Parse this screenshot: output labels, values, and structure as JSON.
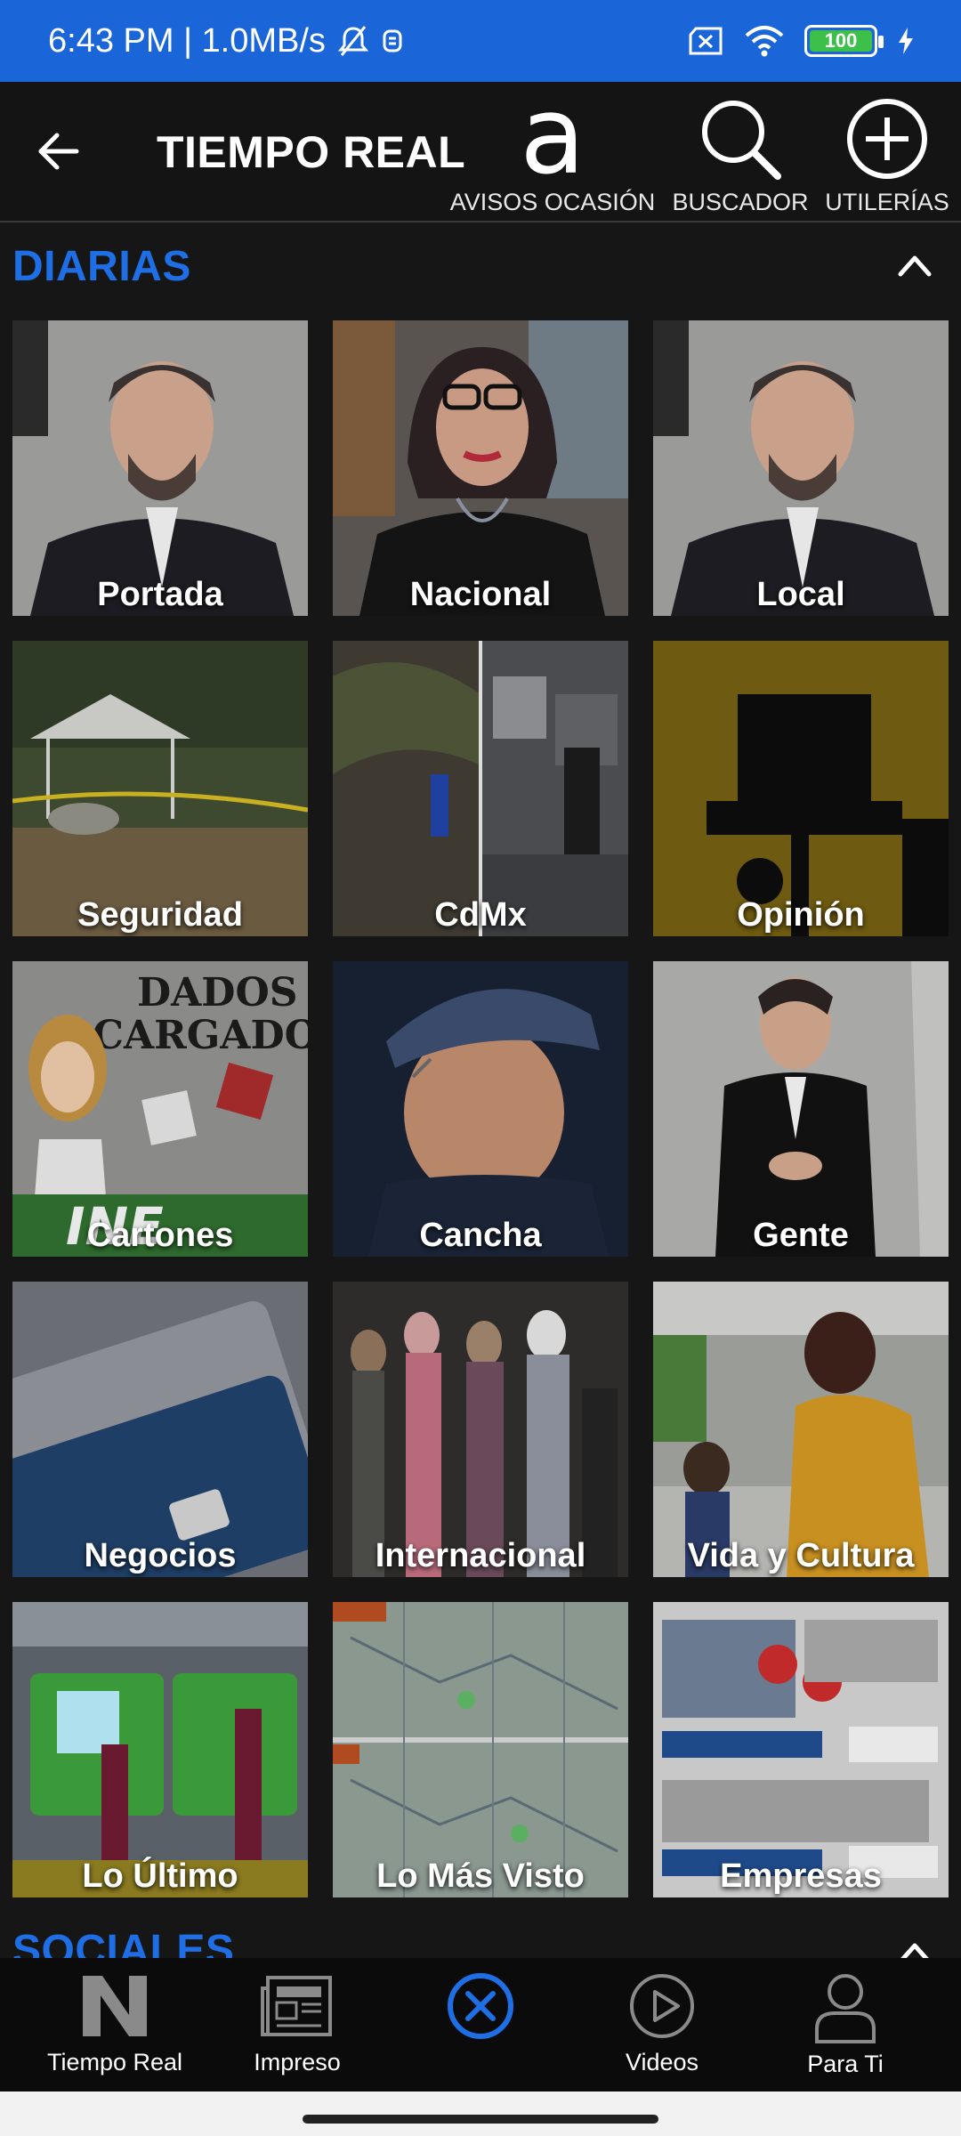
{
  "status": {
    "time_speed": "6:43 PM | 1.0MB/s",
    "battery": "100",
    "icons": [
      "bell-muted-icon",
      "alarm-icon",
      "sim-off-icon",
      "wifi-icon",
      "battery-icon",
      "charging-icon"
    ]
  },
  "header": {
    "title": "TIEMPO REAL",
    "back_icon": "arrow-left-icon",
    "avisos_glyph": "a",
    "actions": [
      {
        "label": "AVISOS OCASIÓN",
        "icon": "avisos-logo-icon"
      },
      {
        "label": "BUSCADOR",
        "icon": "search-icon"
      },
      {
        "label": "UTILERÍAS",
        "icon": "plus-circle-icon"
      }
    ]
  },
  "sections": {
    "diarias": "DIARIAS",
    "sociales": "SOCIALES"
  },
  "tiles": [
    {
      "label": "Portada"
    },
    {
      "label": "Nacional"
    },
    {
      "label": "Local"
    },
    {
      "label": "Seguridad"
    },
    {
      "label": "CdMx"
    },
    {
      "label": "Opinión"
    },
    {
      "label": "Cartones"
    },
    {
      "label": "Cancha"
    },
    {
      "label": "Gente"
    },
    {
      "label": "Negocios"
    },
    {
      "label": "Internacional"
    },
    {
      "label": "Vida y Cultura"
    },
    {
      "label": "Lo Último"
    },
    {
      "label": "Lo Más Visto"
    },
    {
      "label": "Empresas"
    }
  ],
  "bottom_nav": [
    {
      "label": "Tiempo Real",
      "icon": "n-logo-icon"
    },
    {
      "label": "Impreso",
      "icon": "newspaper-icon"
    },
    {
      "label": "",
      "icon": "close-circle-icon"
    },
    {
      "label": "Videos",
      "icon": "play-circle-icon"
    },
    {
      "label": "Para Ti",
      "icon": "user-icon"
    }
  ],
  "colors": {
    "status_bar": "#1a66d8",
    "accent": "#1e6fe6",
    "background": "#161616",
    "battery": "#3cc04a"
  }
}
